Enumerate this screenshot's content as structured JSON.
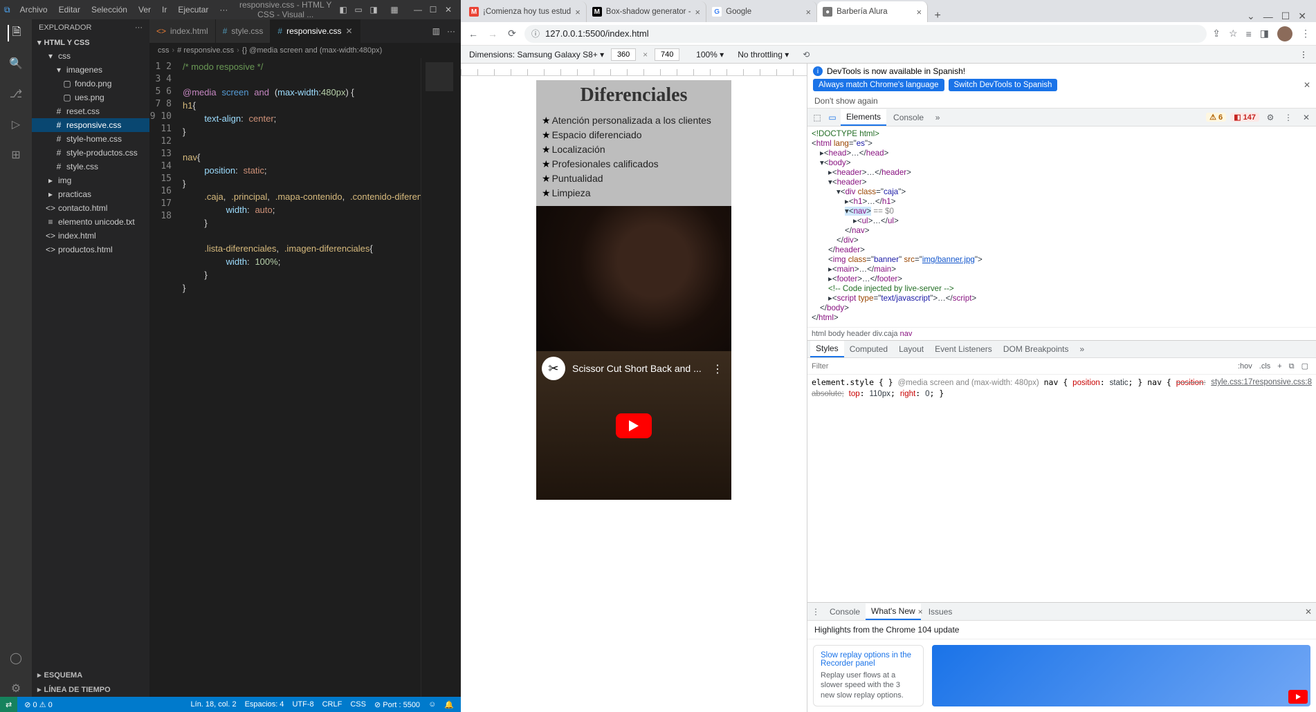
{
  "vscode": {
    "menus": [
      "Archivo",
      "Editar",
      "Selección",
      "Ver",
      "Ir",
      "Ejecutar",
      "···"
    ],
    "title": "responsive.css - HTML Y CSS - Visual ...",
    "explorer": {
      "title": "EXPLORADOR",
      "project": "HTML Y CSS",
      "tree": [
        {
          "depth": 1,
          "icon": "▾",
          "label": "css",
          "type": "folder"
        },
        {
          "depth": 2,
          "icon": "▾",
          "label": "imagenes",
          "type": "folder"
        },
        {
          "depth": 3,
          "icon": "▢",
          "label": "fondo.png",
          "type": "img"
        },
        {
          "depth": 3,
          "icon": "▢",
          "label": "ues.png",
          "type": "img"
        },
        {
          "depth": 2,
          "icon": "#",
          "label": "reset.css",
          "type": "css"
        },
        {
          "depth": 2,
          "icon": "#",
          "label": "responsive.css",
          "type": "css",
          "active": true
        },
        {
          "depth": 2,
          "icon": "#",
          "label": "style-home.css",
          "type": "css"
        },
        {
          "depth": 2,
          "icon": "#",
          "label": "style-productos.css",
          "type": "css"
        },
        {
          "depth": 2,
          "icon": "#",
          "label": "style.css",
          "type": "css"
        },
        {
          "depth": 1,
          "icon": "▸",
          "label": "img",
          "type": "folder"
        },
        {
          "depth": 1,
          "icon": "▸",
          "label": "practicas",
          "type": "folder"
        },
        {
          "depth": 1,
          "icon": "<>",
          "label": "contacto.html",
          "type": "html"
        },
        {
          "depth": 1,
          "icon": "≡",
          "label": "elemento unicode.txt",
          "type": "txt"
        },
        {
          "depth": 1,
          "icon": "<>",
          "label": "index.html",
          "type": "html"
        },
        {
          "depth": 1,
          "icon": "<>",
          "label": "productos.html",
          "type": "html"
        }
      ],
      "collapsed": [
        "ESQUEMA",
        "LÍNEA DE TIEMPO"
      ]
    },
    "tabs": [
      {
        "icon": "<>",
        "label": "index.html"
      },
      {
        "icon": "#",
        "label": "style.css"
      },
      {
        "icon": "#",
        "label": "responsive.css",
        "active": true,
        "dirty": true
      }
    ],
    "breadcrumbs": [
      "css",
      "# responsive.css",
      "{} @media screen and (max-width:480px)"
    ],
    "code": {
      "lines": [
        {
          "n": 1,
          "html": "<span class='t-com'>/* modo resposive */</span>"
        },
        {
          "n": 2,
          "html": ""
        },
        {
          "n": 3,
          "html": "<span class='t-kw'>@media</span> <span class='t-fn'>screen</span> <span class='t-kw'>and</span> <span class='t-pun'>(</span><span class='t-prop'>max-width</span><span class='t-pun'>:</span><span class='t-num'>480px</span><span class='t-pun'>) {</span>"
        },
        {
          "n": 4,
          "html": "<span class='t-sel'>h1</span><span class='t-pun'>{</span>"
        },
        {
          "n": 5,
          "html": "    <span class='t-prop'>text-align</span><span class='t-pun'>:</span> <span class='t-val'>center</span><span class='t-pun'>;</span>"
        },
        {
          "n": 6,
          "html": "<span class='t-pun'>}</span>"
        },
        {
          "n": 7,
          "html": ""
        },
        {
          "n": 8,
          "html": "<span class='t-sel'>nav</span><span class='t-pun'>{</span>"
        },
        {
          "n": 9,
          "html": "    <span class='t-prop'>position</span><span class='t-pun'>:</span> <span class='t-val'>static</span><span class='t-pun'>;</span>"
        },
        {
          "n": 10,
          "html": "<span class='t-pun'>}</span>"
        },
        {
          "n": 11,
          "html": "    <span class='t-sel'>.caja</span><span class='t-pun'>,</span> <span class='t-sel'>.principal</span><span class='t-pun'>,</span> <span class='t-sel'>.mapa-contenido</span><span class='t-pun'>,</span> <span class='t-sel'>.contenido-diferencial</span>"
        },
        {
          "n": 12,
          "html": "        <span class='t-prop'>width</span><span class='t-pun'>:</span> <span class='t-val'>auto</span><span class='t-pun'>;</span>"
        },
        {
          "n": 13,
          "html": "    <span class='t-pun'>}</span>"
        },
        {
          "n": 14,
          "html": ""
        },
        {
          "n": 15,
          "html": "    <span class='t-sel'>.lista-diferenciales</span><span class='t-pun'>,</span> <span class='t-sel'>.imagen-diferenciales</span><span class='t-pun'>{</span>"
        },
        {
          "n": 16,
          "html": "        <span class='t-prop'>width</span><span class='t-pun'>:</span> <span class='t-num'>100%</span><span class='t-pun'>;</span>"
        },
        {
          "n": 17,
          "html": "    <span class='t-pun'>}</span>"
        },
        {
          "n": 18,
          "html": "<span class='t-pun'>}</span>"
        }
      ]
    },
    "status": {
      "remote": "⇄",
      "problems": "⊘ 0 ⚠ 0",
      "pos": "Lín. 18, col. 2",
      "spaces": "Espacios: 4",
      "enc": "UTF-8",
      "eol": "CRLF",
      "lang": "CSS",
      "port": "⊘ Port : 5500"
    }
  },
  "chrome": {
    "tabs": [
      {
        "fav": "M",
        "favbg": "#ea4335",
        "favcol": "#fff",
        "title": "¡Comienza hoy tus estud"
      },
      {
        "fav": "M",
        "favbg": "#000",
        "favcol": "#fff",
        "title": "Box-shadow generator - "
      },
      {
        "fav": "G",
        "favbg": "#fff",
        "favcol": "#4285f4",
        "title": "Google"
      },
      {
        "fav": "●",
        "favbg": "#777",
        "favcol": "#fff",
        "title": "Barbería Alura",
        "active": true
      }
    ],
    "url": "127.0.0.1:5500/index.html",
    "device_bar": {
      "device": "Dimensions: Samsung Galaxy S8+ ▾",
      "w": "360",
      "h": "740",
      "zoom": "100% ▾",
      "throttle": "No throttling ▾"
    },
    "page": {
      "heading": "Diferenciales",
      "items": [
        "Atención personalizada a los clientes",
        "Espacio diferenciado",
        "Localización",
        "Profesionales calificados",
        "Puntualidad",
        "Limpieza"
      ],
      "video_title": "Scissor Cut Short Back and ..."
    },
    "devtools": {
      "banner": {
        "msg": "DevTools is now available in Spanish!",
        "btn1": "Always match Chrome's language",
        "btn2": "Switch DevTools to Spanish",
        "dont": "Don't show again"
      },
      "tabs": [
        "Elements",
        "Console"
      ],
      "warn_count": "⚠ 6",
      "err_count": "◧ 147",
      "dom_lines": [
        {
          "pad": 0,
          "html": "<span class='cm'>&lt;!DOCTYPE html&gt;</span>"
        },
        {
          "pad": 0,
          "html": "&lt;<span class='tg'>html</span> <span class='an'>lang</span>=\"<span class='av'>es</span>\"&gt;"
        },
        {
          "pad": 1,
          "html": "▸&lt;<span class='tg'>head</span>&gt;…&lt;/<span class='tg'>head</span>&gt;"
        },
        {
          "pad": 1,
          "html": "▾&lt;<span class='tg'>body</span>&gt;"
        },
        {
          "pad": 2,
          "html": "▸&lt;<span class='tg'>header</span>&gt;…&lt;/<span class='tg'>header</span>&gt;"
        },
        {
          "pad": 2,
          "html": "▾&lt;<span class='tg'>header</span>&gt;"
        },
        {
          "pad": 3,
          "html": "▾&lt;<span class='tg'>div</span> <span class='an'>class</span>=\"<span class='av'>caja</span>\"&gt;"
        },
        {
          "pad": 4,
          "html": "▸&lt;<span class='tg'>h1</span>&gt;…&lt;/<span class='tg'>h1</span>&gt;"
        },
        {
          "pad": 4,
          "html": "<span class='sel'>▾&lt;<span class='tg'>nav</span>&gt;</span> <span class='hint'>== $0</span>"
        },
        {
          "pad": 5,
          "html": "▸&lt;<span class='tg'>ul</span>&gt;…&lt;/<span class='tg'>ul</span>&gt;"
        },
        {
          "pad": 4,
          "html": "&lt;/<span class='tg'>nav</span>&gt;"
        },
        {
          "pad": 3,
          "html": "&lt;/<span class='tg'>div</span>&gt;"
        },
        {
          "pad": 2,
          "html": "&lt;/<span class='tg'>header</span>&gt;"
        },
        {
          "pad": 2,
          "html": "&lt;<span class='tg'>img</span> <span class='an'>class</span>=\"<span class='av'>banner</span>\" <span class='an'>src</span>=\"<span class='link'>img/banner.jpg</span>\"&gt;"
        },
        {
          "pad": 2,
          "html": "▸&lt;<span class='tg'>main</span>&gt;…&lt;/<span class='tg'>main</span>&gt;"
        },
        {
          "pad": 2,
          "html": "▸&lt;<span class='tg'>footer</span>&gt;…&lt;/<span class='tg'>footer</span>&gt;"
        },
        {
          "pad": 2,
          "html": "<span class='cm'>&lt;!-- Code injected by live-server --&gt;</span>"
        },
        {
          "pad": 2,
          "html": "▸&lt;<span class='tg'>script</span> <span class='an'>type</span>=\"<span class='av'>text/javascript</span>\"&gt;…&lt;/<span class='tg'>script</span>&gt;"
        },
        {
          "pad": 1,
          "html": "&lt;/<span class='tg'>body</span>&gt;"
        },
        {
          "pad": 0,
          "html": "&lt;/<span class='tg'>html</span>&gt;"
        }
      ],
      "crumb": "html  body  header  div.caja  ",
      "crumb_cur": "nav",
      "styles_tabs": [
        "Styles",
        "Computed",
        "Layout",
        "Event Listeners",
        "DOM Breakpoints"
      ],
      "filter_ph": "Filter",
      "filter_opts": [
        ":hov",
        ".cls",
        "+",
        "⧉",
        "▢"
      ],
      "rules_html": "element.style {\n}\n<span class='rule-src'><a>responsive.css:8</a></span><span style='color:#888'>@media screen and (max-width: 480px)</span>\nnav {\n    <span class='prop'>position</span>: <span class='pv'>static</span>;\n}\n\n<span class='rule-src'><a>style.css:17</a></span>nav {\n    <span class='strike'><span class='prop'>position</span>: absolute;</span>\n    <span class='prop'>top</span>: <span class='pv'>110px</span>;\n    <span class='prop'>right</span>: <span class='pv'>0</span>;\n}",
      "drawer_tabs": [
        "Console",
        "What's New",
        "Issues"
      ],
      "highlights": "Highlights from the Chrome 104 update",
      "promo": {
        "h": "Slow replay options in the Recorder panel",
        "b": "Replay user flows at a slower speed with the 3 new slow replay options."
      }
    }
  }
}
